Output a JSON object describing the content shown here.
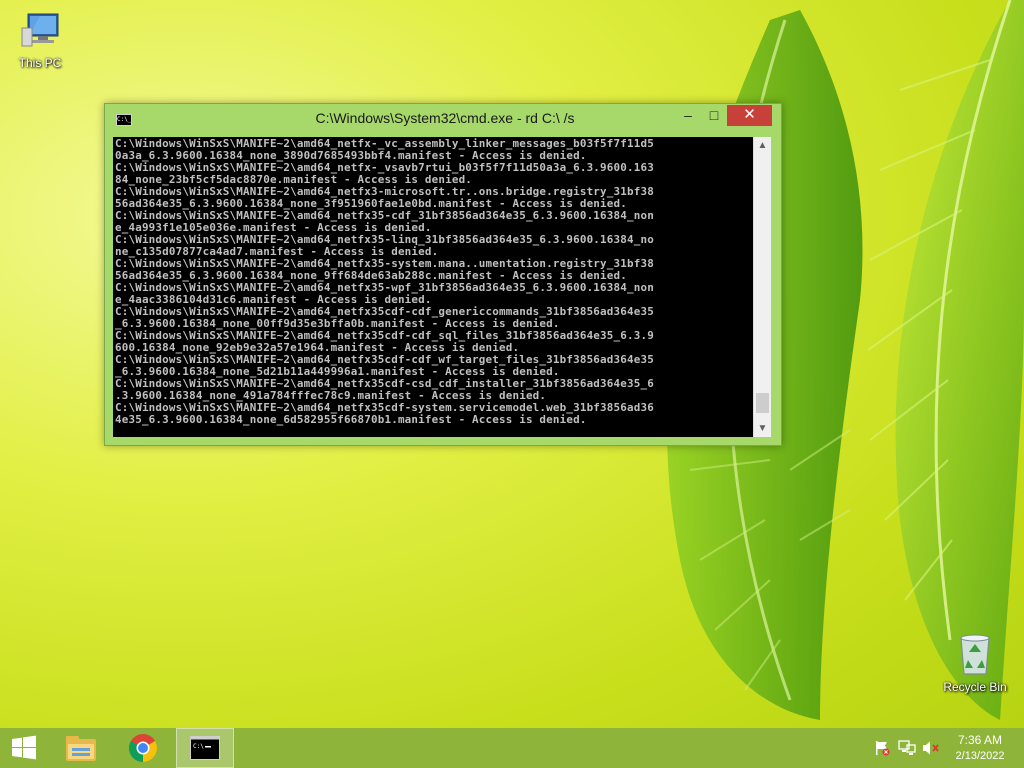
{
  "desktop": {
    "icons": [
      {
        "label": "This PC",
        "icon": "computer-icon"
      },
      {
        "label": "Recycle Bin",
        "icon": "recycle-bin-icon"
      }
    ]
  },
  "window": {
    "title": "C:\\Windows\\System32\\cmd.exe - rd  C:\\ /s",
    "icon": "cmd-icon",
    "buttons": {
      "minimize": "–",
      "maximize": "□",
      "close": "✕"
    },
    "console_lines": [
      "C:\\Windows\\WinSxS\\MANIFE~2\\amd64_netfx-_vc_assembly_linker_messages_b03f5f7f11d5",
      "0a3a_6.3.9600.16384_none_3890d7685493bbf4.manifest - Access is denied.",
      "C:\\Windows\\WinSxS\\MANIFE~2\\amd64_netfx-_vsavb7rtui_b03f5f7f11d50a3a_6.3.9600.163",
      "84_none_23bf5cf5dac8870e.manifest - Access is denied.",
      "C:\\Windows\\WinSxS\\MANIFE~2\\amd64_netfx3-microsoft.tr..ons.bridge.registry_31bf38",
      "56ad364e35_6.3.9600.16384_none_3f951960fae1e0bd.manifest - Access is denied.",
      "C:\\Windows\\WinSxS\\MANIFE~2\\amd64_netfx35-cdf_31bf3856ad364e35_6.3.9600.16384_non",
      "e_4a993f1e105e036e.manifest - Access is denied.",
      "C:\\Windows\\WinSxS\\MANIFE~2\\amd64_netfx35-linq_31bf3856ad364e35_6.3.9600.16384_no",
      "ne_c135d07877ca4ad7.manifest - Access is denied.",
      "C:\\Windows\\WinSxS\\MANIFE~2\\amd64_netfx35-system.mana..umentation.registry_31bf38",
      "56ad364e35_6.3.9600.16384_none_9ff684de63ab288c.manifest - Access is denied.",
      "C:\\Windows\\WinSxS\\MANIFE~2\\amd64_netfx35-wpf_31bf3856ad364e35_6.3.9600.16384_non",
      "e_4aac3386104d31c6.manifest - Access is denied.",
      "C:\\Windows\\WinSxS\\MANIFE~2\\amd64_netfx35cdf-cdf_genericcommands_31bf3856ad364e35",
      "_6.3.9600.16384_none_00ff9d35e3bffa0b.manifest - Access is denied.",
      "C:\\Windows\\WinSxS\\MANIFE~2\\amd64_netfx35cdf-cdf_sql_files_31bf3856ad364e35_6.3.9",
      "600.16384_none_92eb9e32a57e1964.manifest - Access is denied.",
      "C:\\Windows\\WinSxS\\MANIFE~2\\amd64_netfx35cdf-cdf_wf_target_files_31bf3856ad364e35",
      "_6.3.9600.16384_none_5d21b11a449996a1.manifest - Access is denied.",
      "C:\\Windows\\WinSxS\\MANIFE~2\\amd64_netfx35cdf-csd_cdf_installer_31bf3856ad364e35_6",
      ".3.9600.16384_none_491a784fffec78c9.manifest - Access is denied.",
      "C:\\Windows\\WinSxS\\MANIFE~2\\amd64_netfx35cdf-system.servicemodel.web_31bf3856ad36",
      "4e35_6.3.9600.16384_none_6d582955f66870b1.manifest - Access is denied."
    ],
    "scroll_position": 0.97
  },
  "taskbar": {
    "items": [
      "start-icon",
      "file-explorer-icon",
      "chrome-icon",
      "command-prompt-icon"
    ],
    "active": "command-prompt-icon",
    "tray_icons": [
      "action-center-flag-icon",
      "network-icon",
      "volume-muted-icon"
    ],
    "time": "7:36 AM",
    "date": "2/13/2022"
  },
  "colors": {
    "window_frame": "#a6d86a",
    "close_button": "#c7403a",
    "console_bg": "#000000",
    "console_text": "#c0c0c0",
    "taskbar": "#8fb43a"
  }
}
